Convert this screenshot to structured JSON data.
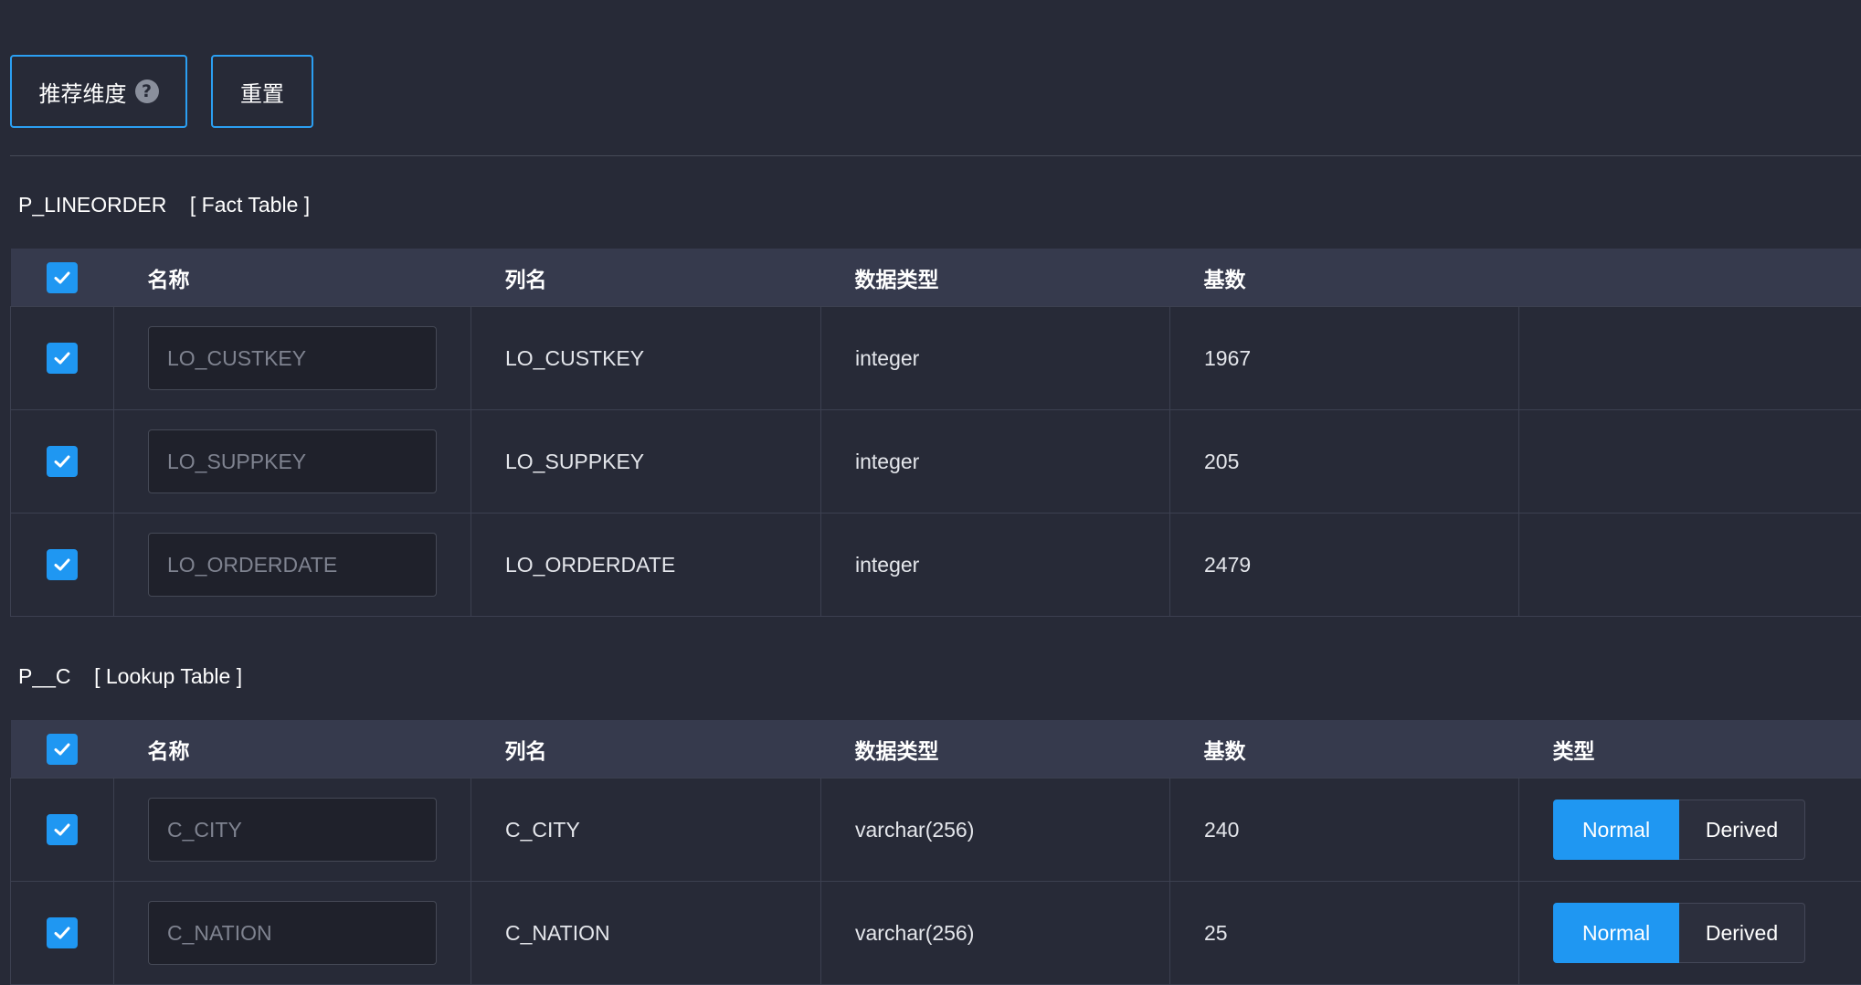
{
  "toolbar": {
    "recommend_label": "推荐维度",
    "help_icon": "?",
    "reset_label": "重置"
  },
  "columns": {
    "name": "名称",
    "column": "列名",
    "data_type": "数据类型",
    "cardinality": "基数",
    "type": "类型"
  },
  "fact_table": {
    "name": "P_LINEORDER",
    "kind": "[ Fact Table ]",
    "rows": [
      {
        "name_placeholder": "LO_CUSTKEY",
        "column": "LO_CUSTKEY",
        "data_type": "integer",
        "cardinality": "1967",
        "checked": true
      },
      {
        "name_placeholder": "LO_SUPPKEY",
        "column": "LO_SUPPKEY",
        "data_type": "integer",
        "cardinality": "205",
        "checked": true
      },
      {
        "name_placeholder": "LO_ORDERDATE",
        "column": "LO_ORDERDATE",
        "data_type": "integer",
        "cardinality": "2479",
        "checked": true
      }
    ]
  },
  "lookup_table": {
    "name": "P__C",
    "kind": "[ Lookup Table ]",
    "rows": [
      {
        "name_placeholder": "C_CITY",
        "column": "C_CITY",
        "data_type": "varchar(256)",
        "cardinality": "240",
        "type_normal": "Normal",
        "type_derived": "Derived",
        "selected": "Normal",
        "checked": true
      },
      {
        "name_placeholder": "C_NATION",
        "column": "C_NATION",
        "data_type": "varchar(256)",
        "cardinality": "25",
        "type_normal": "Normal",
        "type_derived": "Derived",
        "selected": "Normal",
        "checked": true
      }
    ]
  },
  "colors": {
    "accent": "#1f97f2",
    "background": "#272a37",
    "header": "#363a4d"
  }
}
